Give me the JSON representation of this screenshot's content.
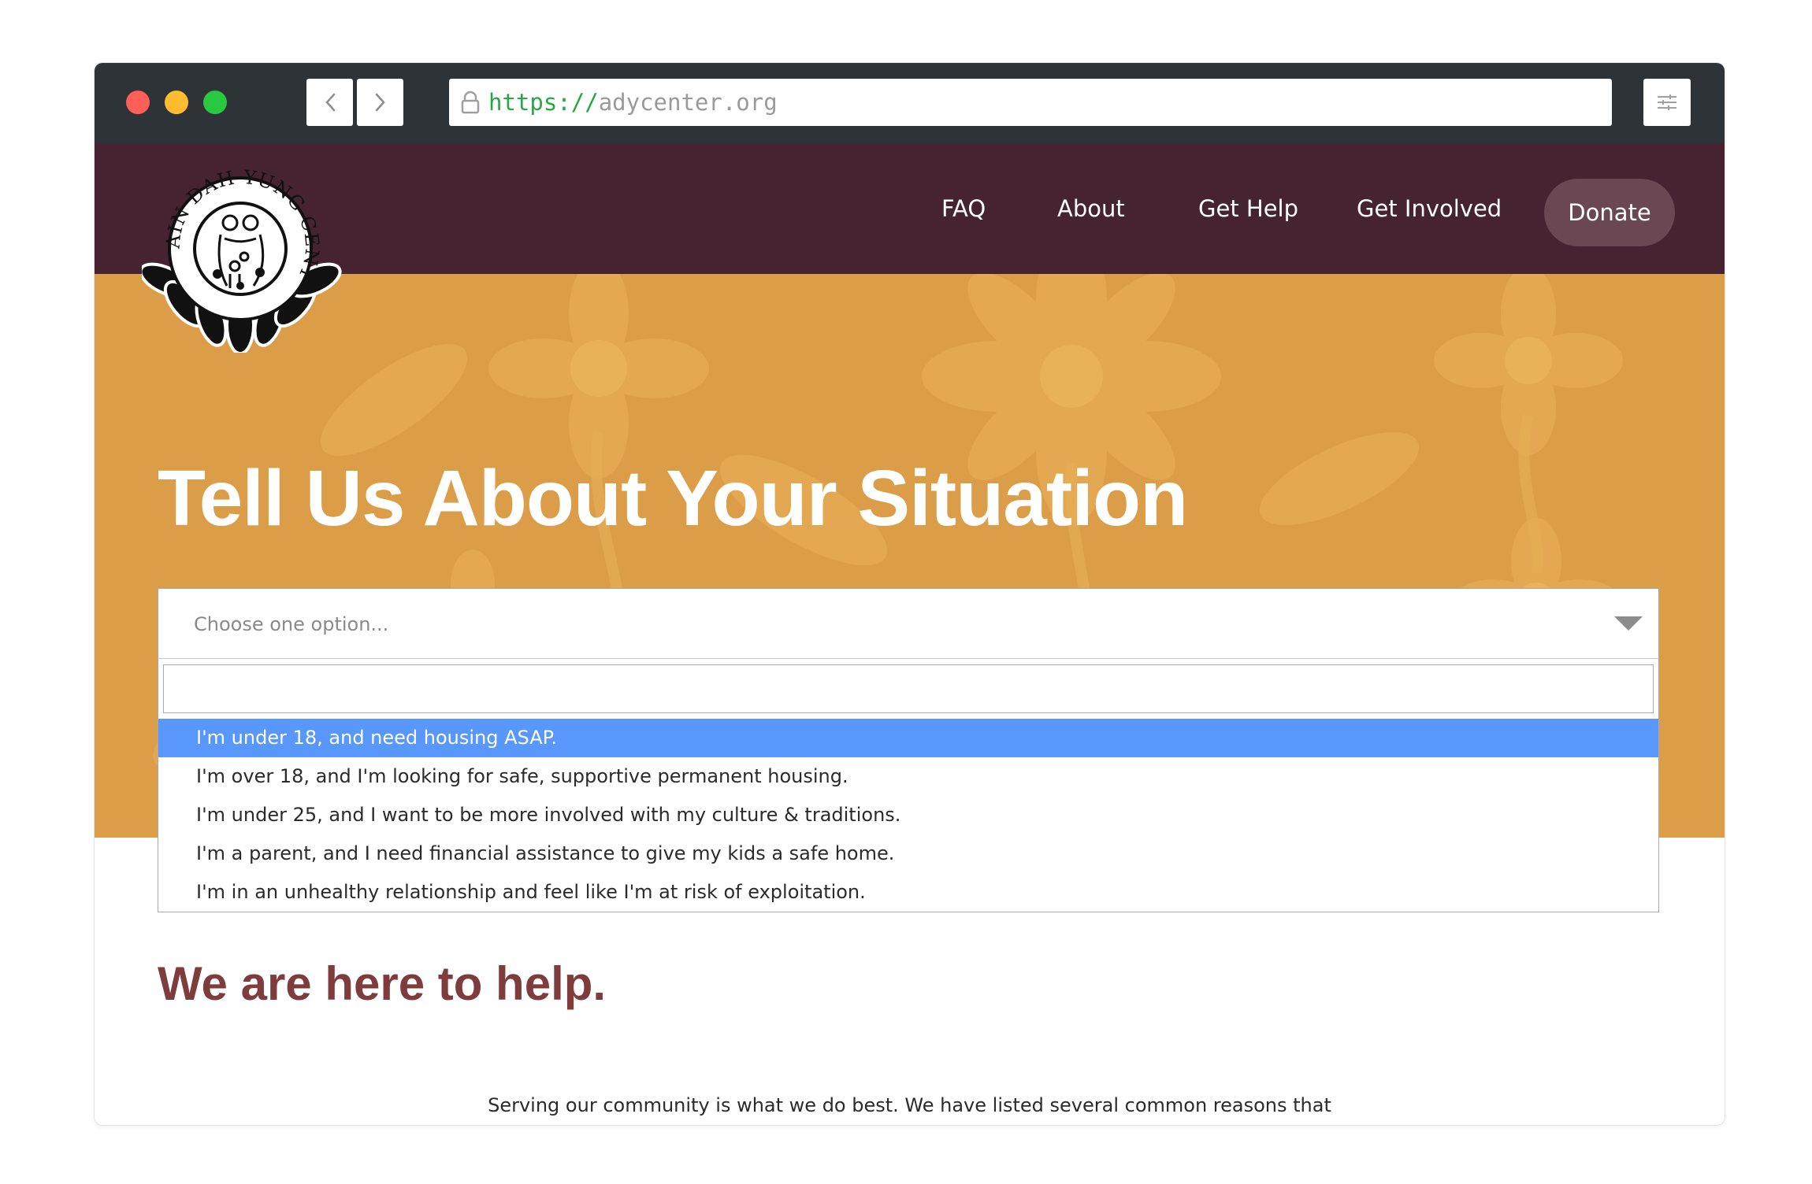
{
  "browser": {
    "url_scheme": "https://",
    "url_host": "adycenter.org"
  },
  "nav": {
    "items": [
      "FAQ",
      "About",
      "Get Help",
      "Get Involved"
    ],
    "donate": "Donate"
  },
  "logo": {
    "text": "AIN DAH YUNG CENTER"
  },
  "hero": {
    "title": "Tell Us About Your Situation"
  },
  "select": {
    "placeholder": "Choose one option...",
    "search_value": "",
    "options": [
      "I'm under 18, and need housing ASAP.",
      "I'm over 18, and I'm looking for safe, supportive permanent housing.",
      "I'm under 25, and I want to be more involved with my culture & traditions.",
      "I'm a parent, and I need financial assistance to give my kids a safe home.",
      "I'm in an unhealthy relationship and feel like I'm at risk of exploitation."
    ],
    "highlighted_index": 0
  },
  "content": {
    "heading": "We are here to help.",
    "intro": "Serving our community is what we do best. We have listed several common reasons that"
  },
  "colors": {
    "chrome": "#2e3338",
    "header": "#452330",
    "donate_bg": "#694853",
    "hero": "#dc9d48",
    "highlight": "#5897fb",
    "heading": "#7f3c3d"
  },
  "icons": [
    "lock-icon",
    "chevron-left-icon",
    "chevron-right-icon",
    "sliders-icon",
    "dropdown-arrow-icon"
  ]
}
